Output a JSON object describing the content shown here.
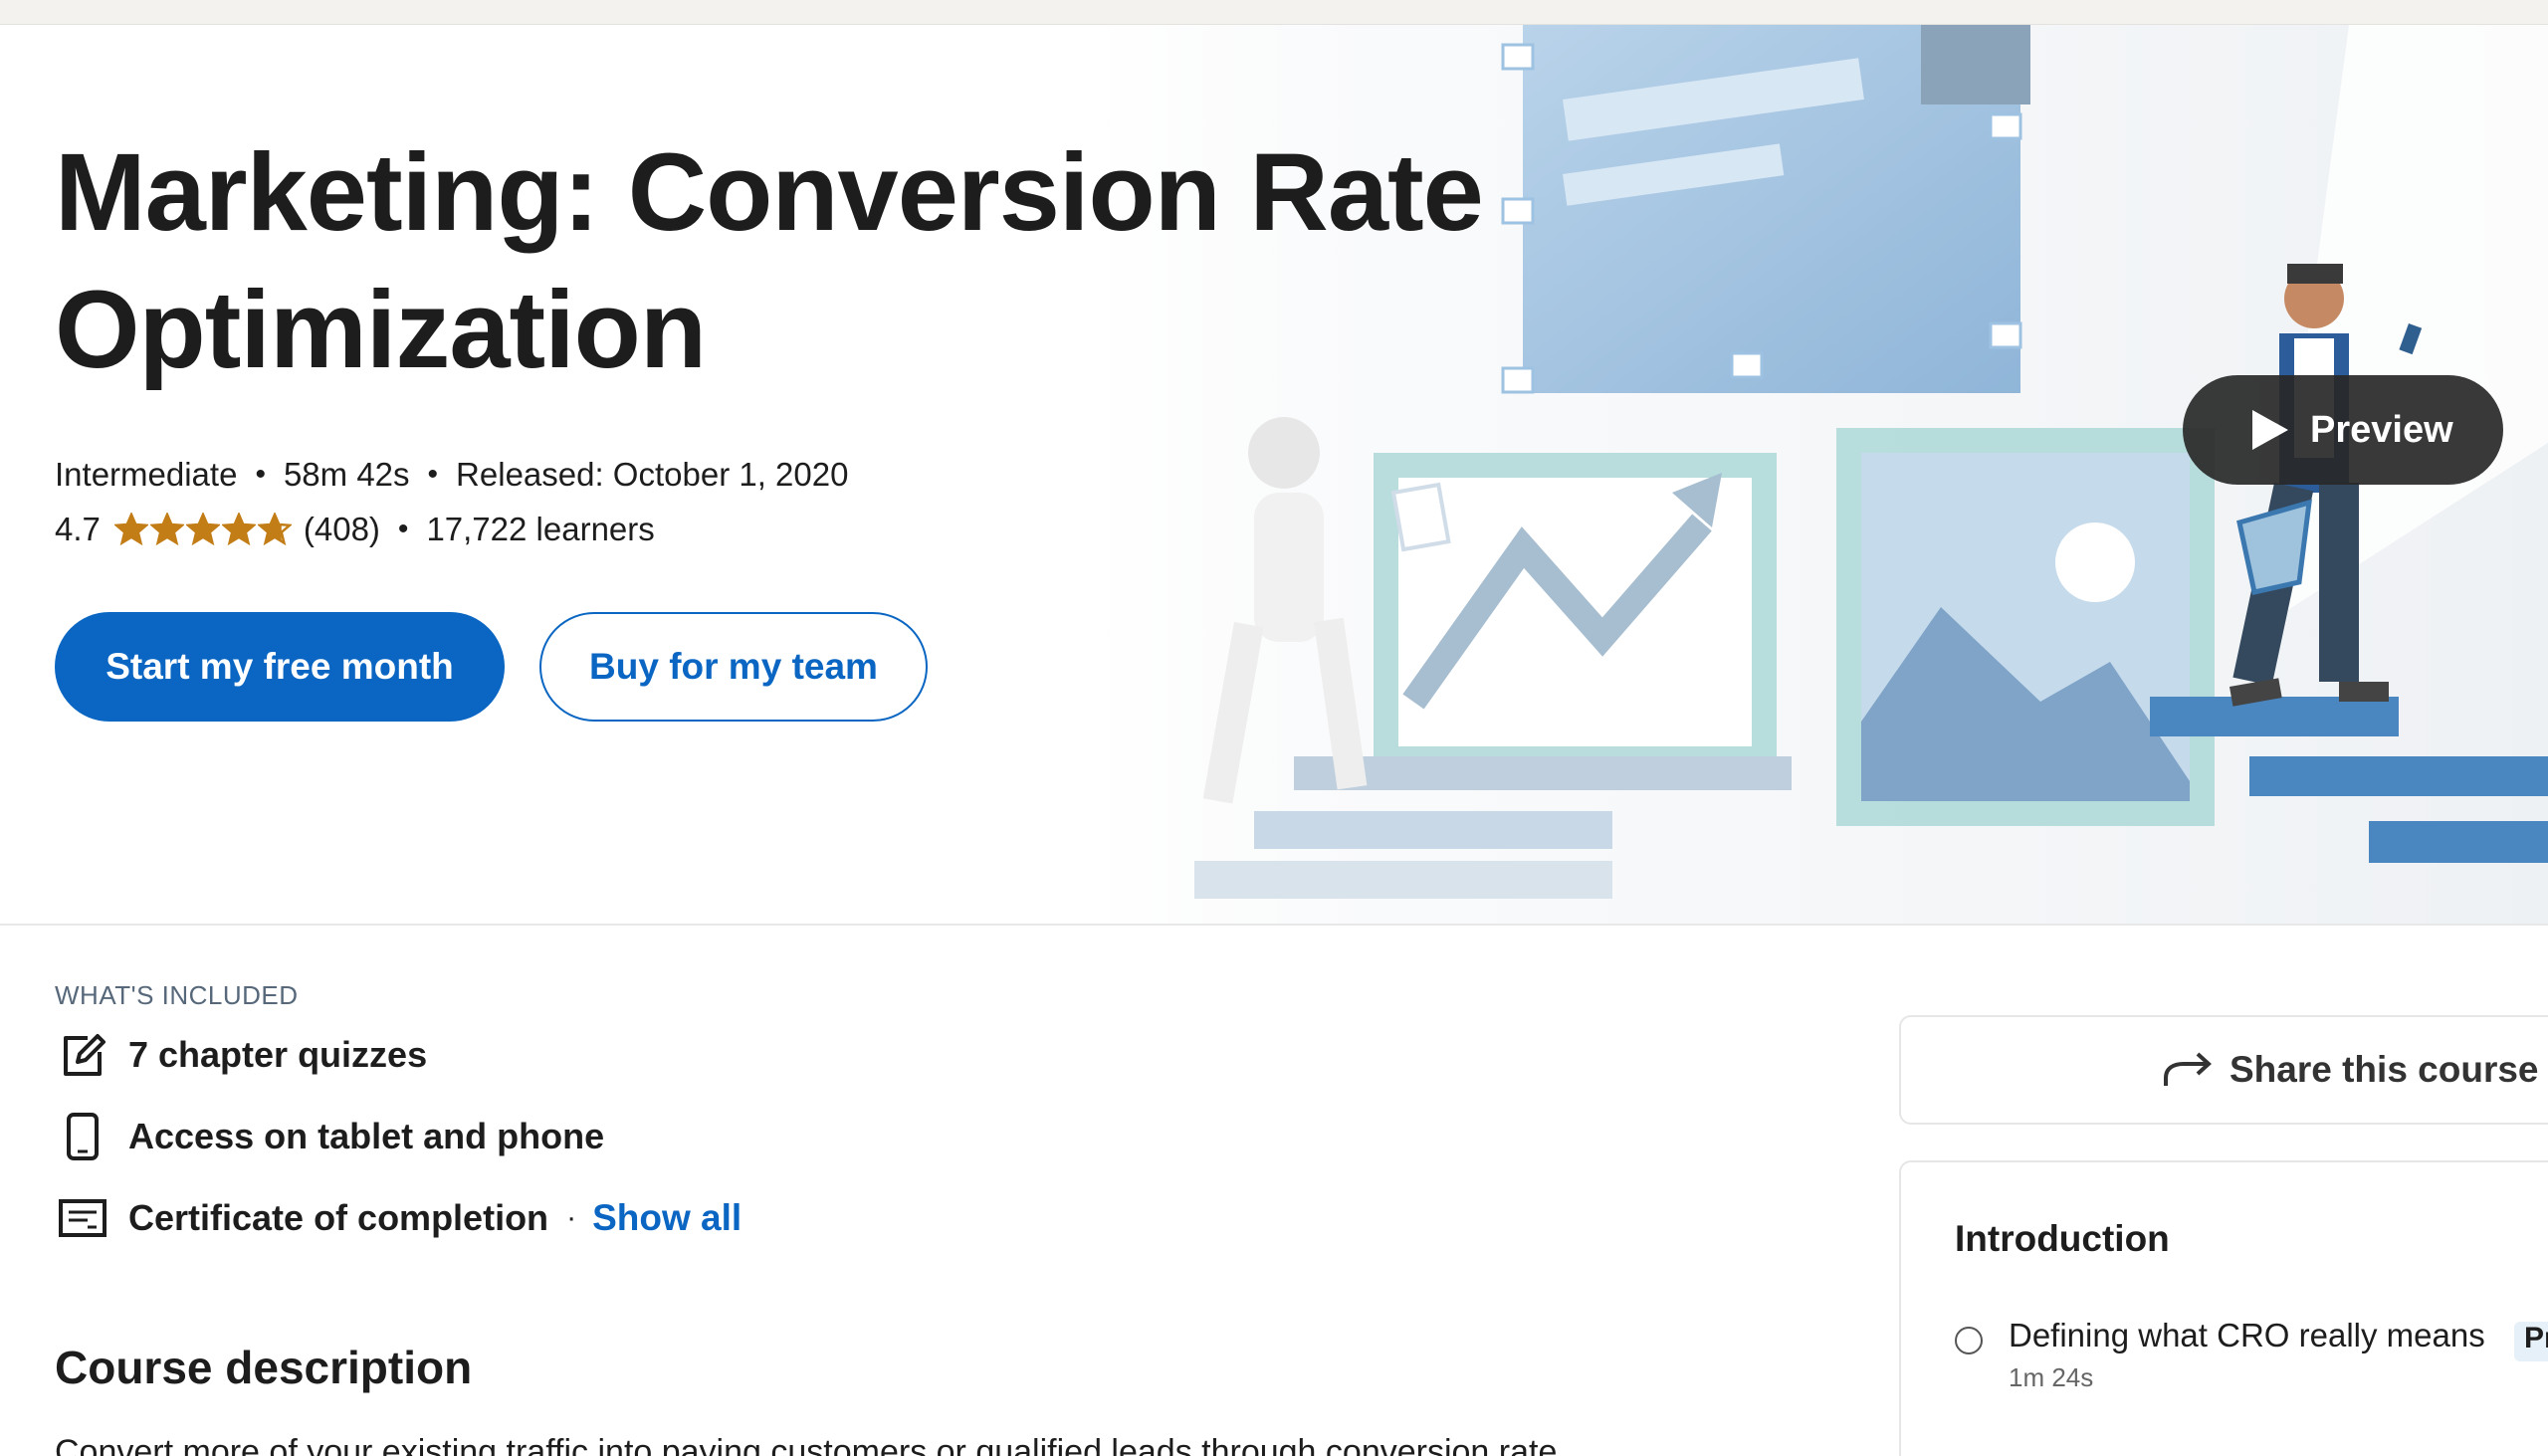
{
  "course": {
    "title": "Marketing: Conversion Rate Optimization",
    "level": "Intermediate",
    "duration": "58m 42s",
    "released": "Released: October 1, 2020",
    "rating": "4.7",
    "rating_value": 4.7,
    "rating_count": "(408)",
    "learners": "17,722 learners"
  },
  "actions": {
    "primary_label": "Start my free month",
    "secondary_label": "Buy for my team",
    "preview_label": "Preview"
  },
  "included": {
    "label": "WHAT'S INCLUDED",
    "items": [
      {
        "icon": "edit-icon",
        "text": "7 chapter quizzes"
      },
      {
        "icon": "phone-icon",
        "text": "Access on tablet and phone"
      },
      {
        "icon": "certificate-icon",
        "text": "Certificate of completion"
      }
    ],
    "show_all": "Show all"
  },
  "description": {
    "title": "Course description",
    "text": "Convert more of your existing traffic into paying customers or qualified leads through conversion rate"
  },
  "sidebar": {
    "share_label": "Share this course",
    "toc": {
      "chapter": "Introduction",
      "items": [
        {
          "title": "Defining what CRO really means",
          "duration": "1m 24s",
          "badge": "Pr"
        }
      ]
    }
  },
  "colors": {
    "brand": "#0a66c2",
    "star": "#c37d16",
    "preview_bg": "#2b2b2b"
  }
}
